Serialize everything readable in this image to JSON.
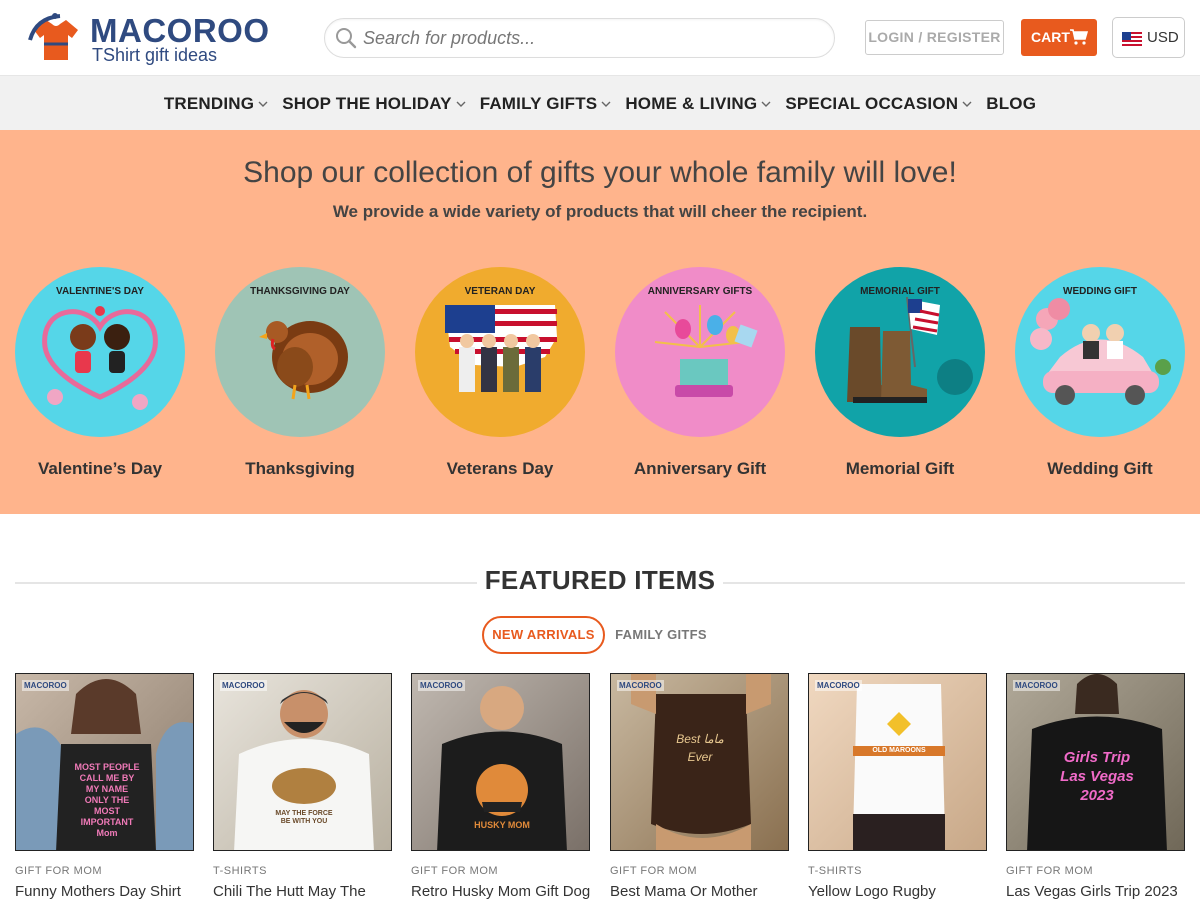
{
  "header": {
    "logo_name": "MACOROO",
    "logo_tagline": "TShirt gift ideas",
    "search_placeholder": "Search for products...",
    "login_label": "LOGIN / REGISTER",
    "cart_label": "CART",
    "currency_label": "USD",
    "accent_color": "#e85a1e",
    "brand_color": "#2f4a80"
  },
  "nav": {
    "items": [
      {
        "label": "TRENDING",
        "has_dropdown": true
      },
      {
        "label": "SHOP THE HOLIDAY",
        "has_dropdown": true
      },
      {
        "label": "FAMILY GIFTS",
        "has_dropdown": true
      },
      {
        "label": "HOME & LIVING",
        "has_dropdown": true
      },
      {
        "label": "SPECIAL OCCASION",
        "has_dropdown": true
      },
      {
        "label": "BLOG",
        "has_dropdown": false
      }
    ]
  },
  "banner": {
    "headline": "Shop our collection of gifts your whole family will love!",
    "subheadline": "We provide a wide variety of products that will cheer the recipient.",
    "background": "#ffb48c",
    "categories": [
      {
        "image_label": "VALENTINE'S DAY",
        "name": "Valentine’s Day",
        "color": "#55d6e8"
      },
      {
        "image_label": "THANKSGIVING DAY",
        "name": "Thanksgiving",
        "color": "#9fc4b5"
      },
      {
        "image_label": "VETERAN DAY",
        "name": "Veterans Day",
        "color": "#f0ab2e"
      },
      {
        "image_label": "ANNIVERSARY GIFTS",
        "name": "Anniversary Gift",
        "color": "#f08cc8"
      },
      {
        "image_label": "MEMORIAL GIFT",
        "name": "Memorial Gift",
        "color": "#11a3a8"
      },
      {
        "image_label": "WEDDING GIFT",
        "name": "Wedding Gift",
        "color": "#55d6e8"
      }
    ]
  },
  "featured": {
    "title": "FEATURED ITEMS",
    "tabs": [
      {
        "label": "NEW ARRIVALS",
        "active": true
      },
      {
        "label": "FAMILY GITFS",
        "active": false
      }
    ],
    "products": [
      {
        "category": "GIFT FOR MOM",
        "title": "Funny Mothers Day Shirt",
        "brand": "MACOROO",
        "shirt_text": "MOST PEOPLE CALL ME BY MY NAME ONLY THE MOST IMPORTANT Mom"
      },
      {
        "category": "T-SHIRTS",
        "title": "Chili The Hutt May The",
        "brand": "MACOROO",
        "shirt_text": "MAY THE FORCE BE WITH YOU"
      },
      {
        "category": "GIFT FOR MOM",
        "title": "Retro Husky Mom Gift Dog",
        "brand": "MACOROO",
        "shirt_text": "HUSKY MOM"
      },
      {
        "category": "GIFT FOR MOM",
        "title": "Best Mama Or Mother",
        "brand": "MACOROO",
        "shirt_text": "Best ماما Ever"
      },
      {
        "category": "T-SHIRTS",
        "title": "Yellow Logo Rugby",
        "brand": "MACOROO",
        "shirt_text": "OLD MAROONS"
      },
      {
        "category": "GIFT FOR MOM",
        "title": "Las Vegas Girls Trip 2023",
        "brand": "MACOROO",
        "shirt_text": "Girls Trip Las Vegas 2023"
      }
    ]
  }
}
